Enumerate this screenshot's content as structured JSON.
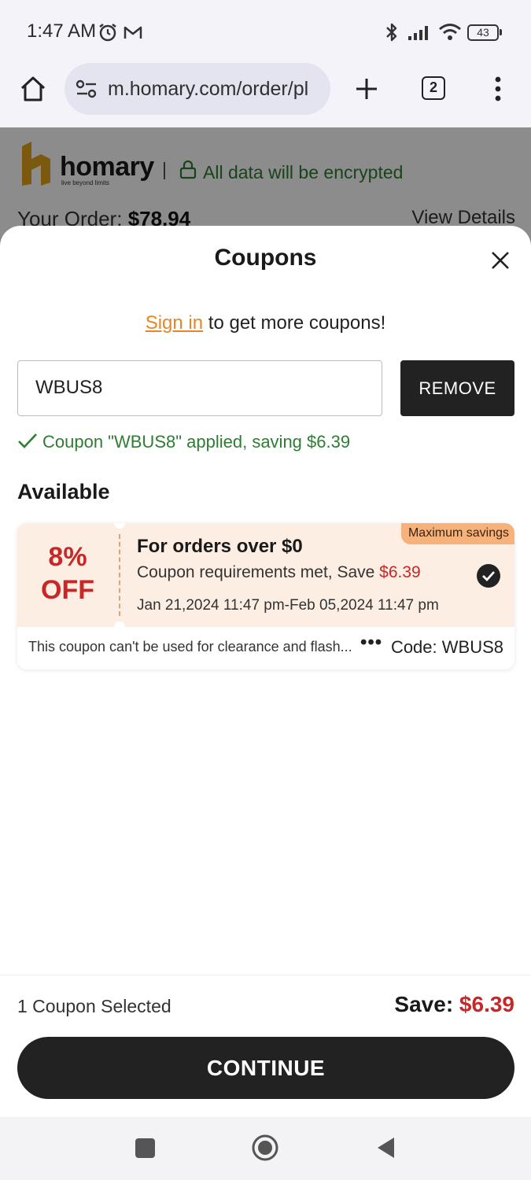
{
  "status_bar": {
    "time": "1:47 AM",
    "battery": "43"
  },
  "browser": {
    "url": "m.homary.com/order/pl",
    "tab_count": "2"
  },
  "background_page": {
    "brand_name": "homary",
    "brand_tagline": "live beyond limits",
    "encryption_note": "All data will be encrypted",
    "order_label": "Your Order:",
    "order_total": "$78.94",
    "view_details": "View Details"
  },
  "sheet": {
    "title": "Coupons",
    "sign_in_link": "Sign in",
    "sign_in_suffix": "to get more coupons",
    "sign_in_exclaim": "!",
    "coupon_input_value": "WBUS8",
    "remove_label": "REMOVE",
    "applied_message": "Coupon \"WBUS8\" applied, saving $6.39",
    "available_title": "Available"
  },
  "coupons": [
    {
      "discount_line1": "8%",
      "discount_line2": "OFF",
      "badge": "Maximum savings",
      "title": "For orders over $0",
      "requirement_text": "Coupon requirements met, Save",
      "requirement_amount": "$6.39",
      "validity": "Jan 21,2024 11:47 pm-Feb 05,2024 11:47 pm",
      "note": "This coupon can't be used for clearance and flash...",
      "more": "•••",
      "code": "Code: WBUS8",
      "selected": true
    }
  ],
  "footer": {
    "selected_count": "1 Coupon Selected",
    "save_label": "Save:",
    "save_amount": "$6.39",
    "continue_label": "CONTINUE"
  },
  "colors": {
    "accent_orange": "#e6862a",
    "success_green": "#2e7d32",
    "price_red": "#c62828",
    "button_dark": "#222222"
  }
}
